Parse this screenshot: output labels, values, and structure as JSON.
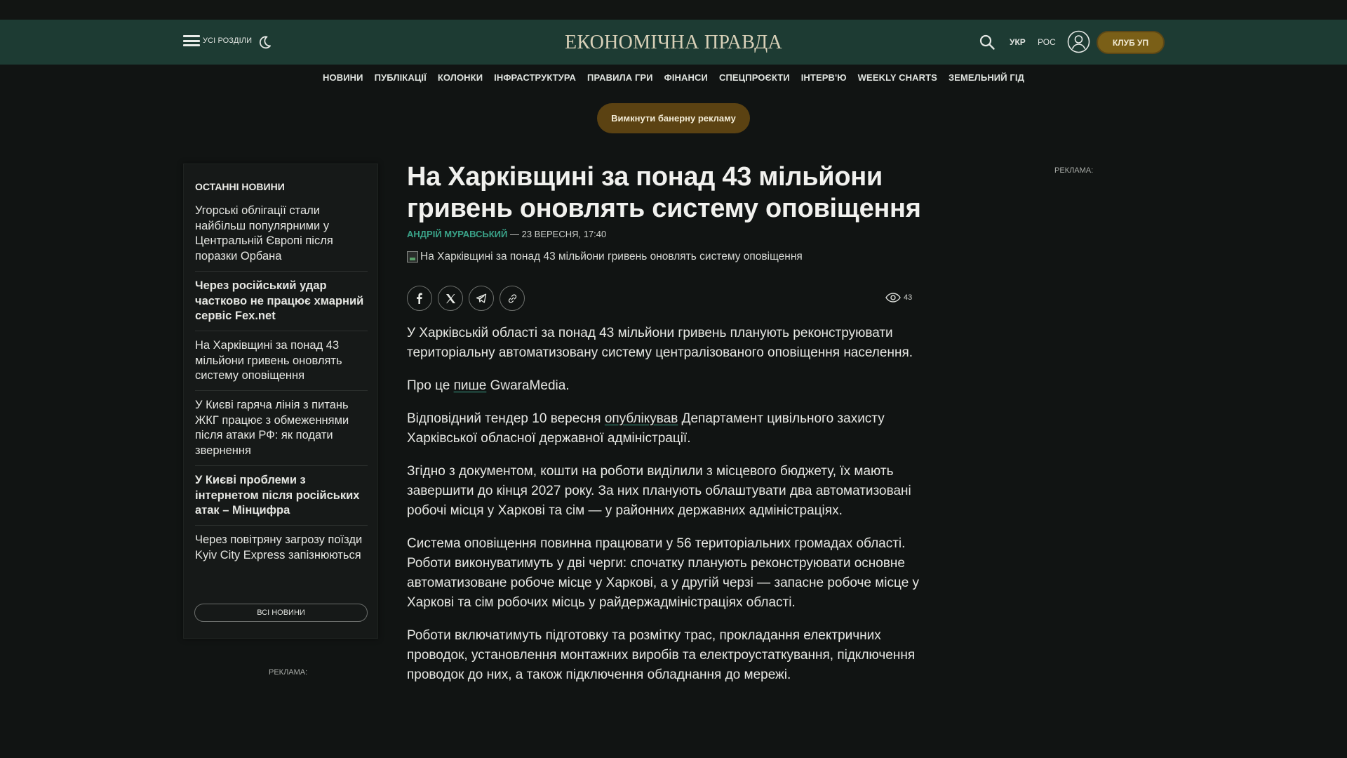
{
  "header": {
    "menu_label": "УСІ РОЗДІЛИ",
    "logo_text": "ЕКОНОМІЧНА ПРАВДА",
    "lang_ukr": "УКР",
    "lang_ros": "РОС",
    "club_label": "КЛУБ УП"
  },
  "nav": {
    "items": [
      "НОВИНИ",
      "ПУБЛІКАЦІЇ",
      "КОЛОНКИ",
      "ІНФРАСТРУКТУРА",
      "ПРАВИЛА ГРИ",
      "ФІНАНСИ",
      "СПЕЦПРОЄКТИ",
      "ІНТЕРВ'Ю",
      "WEEKLY CHARTS",
      "ЗЕМЕЛЬНИЙ ГІД"
    ]
  },
  "ad_banner_button": "Вимкнути банерну рекламу",
  "sidebar": {
    "title": "ОСТАННІ НОВИНИ",
    "items": [
      "Угорські облігації стали найбільш популярними у Центральній Європі після поразки Орбана",
      "Через російський удар частково не працює хмарний сервіс Fex.net",
      "На Харківщині за понад 43 мільйони гривень оновлять систему оповіщення",
      "У Києві гаряча лінія з питань ЖКГ працює з обмеженнями після атаки РФ: як подати звернення",
      "У Києві проблеми з інтернетом після російських атак – Мінцифра",
      "Через повітряну загрозу поїзди Kyiv City Express запізнюються"
    ],
    "all_news": "ВСІ НОВИНИ"
  },
  "ad_label": "РЕКЛАМА:",
  "article": {
    "headline": "На Харківщині за понад 43 мільйони гривень оновлять систему оповіщення",
    "author": "АНДРІЙ МУРАВСЬКИЙ",
    "date": " — 23 ВЕРЕСНЯ, 17:40",
    "image_alt": "На Харківщині за понад 43 мільйони гривень оновлять систему оповіщення",
    "views": "43",
    "p1": "У Харківській області за понад 43 мільйони гривень планують реконструювати територіальну автоматизовану систему централізованого оповіщення населення.",
    "p2_before": "Про це ",
    "p2_link": "пише",
    "p2_after": " GwaraMedia.",
    "p3_before": "Відповідний тендер 10 вересня ",
    "p3_link": "опублікував",
    "p3_after": " Департамент цивільного захисту Харківської обласної державної адміністрації.",
    "p4": "Згідно з документом, кошти на роботи виділили з місцевого бюджету, їх мають завершити до кінця 2027 року. За них планують облаштувати два автоматизовані робочі місця у Харкові та сім — у районних державних адміністраціях.",
    "p5": "Система оповіщення повинна працювати у 56 територіальних громадах області. Роботи виконуватимуть у дві черги: спочатку планують реконструювати основне автоматизоване робоче місце у Харкові, а у другій черзі — запасне робоче місце у Харкові та сім робочих місць у райдержадміністраціях області.",
    "p6": "Роботи включатимуть підготовку та розмітку трас, прокладання електричних проводок, установлення монтажних виробів та електроустаткування, підключення проводок до них, а також підключення обладнання до мережі."
  },
  "colors": {
    "header_bg": "#1d3b33",
    "page_bg": "#111413",
    "accent_green": "#3aa389",
    "club_gold": "#7a5f17"
  }
}
